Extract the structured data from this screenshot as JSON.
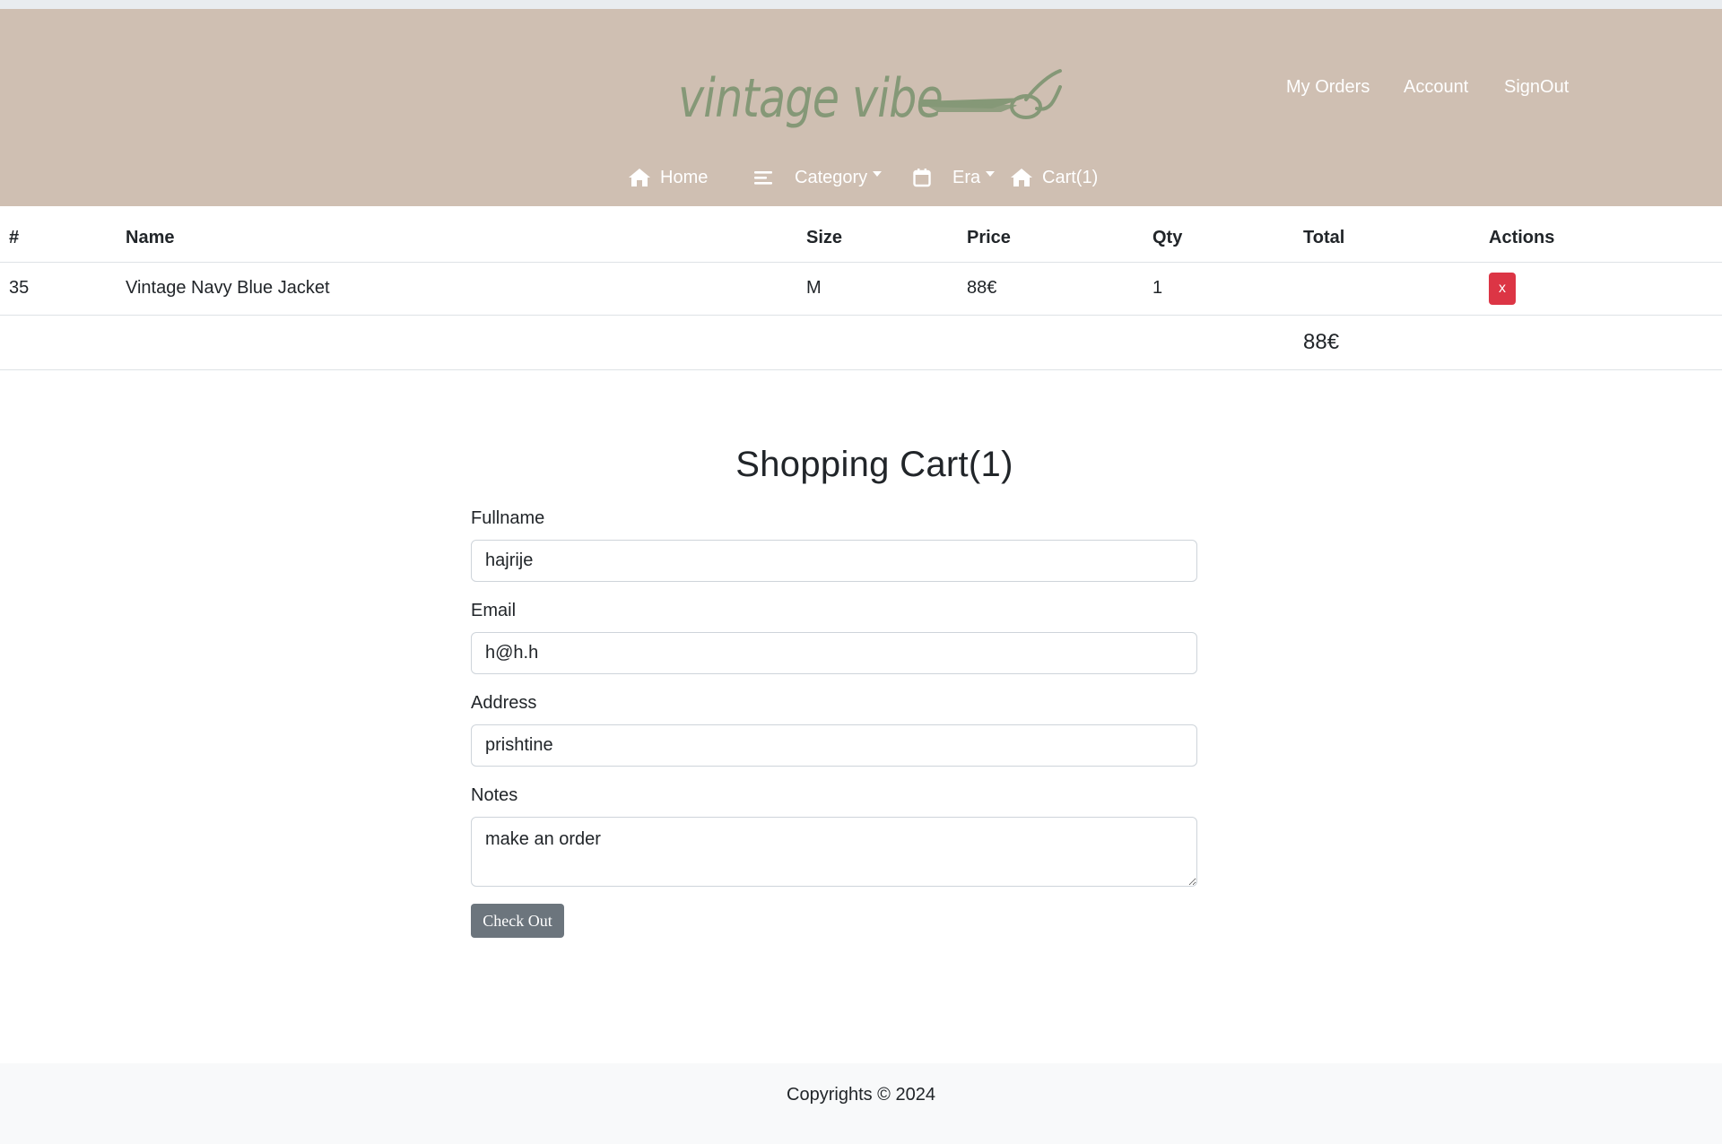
{
  "brand": {
    "logo_text": "vintage vibe",
    "logo_color": "#859877",
    "header_bg": "#cfbfb2"
  },
  "user_nav": {
    "my_orders": "My Orders",
    "account": "Account",
    "signout": "SignOut"
  },
  "main_nav": {
    "home": "Home",
    "category": "Category",
    "era": "Era",
    "cart": "Cart(1)"
  },
  "cart_table": {
    "headers": [
      "#",
      "Name",
      "Size",
      "Price",
      "Qty",
      "Total",
      "Actions"
    ],
    "rows": [
      {
        "id": "35",
        "name": "Vintage Navy Blue Jacket",
        "size": "M",
        "price": "88€",
        "qty": "1",
        "total": "",
        "action": "x"
      }
    ],
    "grand_total": "88€"
  },
  "checkout": {
    "title": "Shopping Cart(1)",
    "fullname_label": "Fullname",
    "fullname_value": "hajrije",
    "email_label": "Email",
    "email_value": "h@h.h",
    "address_label": "Address",
    "address_value": "prishtine",
    "notes_label": "Notes",
    "notes_value": "make an order",
    "submit_label": "Check Out"
  },
  "footer": {
    "copyright": "Copyrights © 2024"
  },
  "icons": {
    "home": "home-icon",
    "category": "list-icon",
    "era": "calendar-icon",
    "cart": "home-icon",
    "logo": "scissors-icon"
  }
}
